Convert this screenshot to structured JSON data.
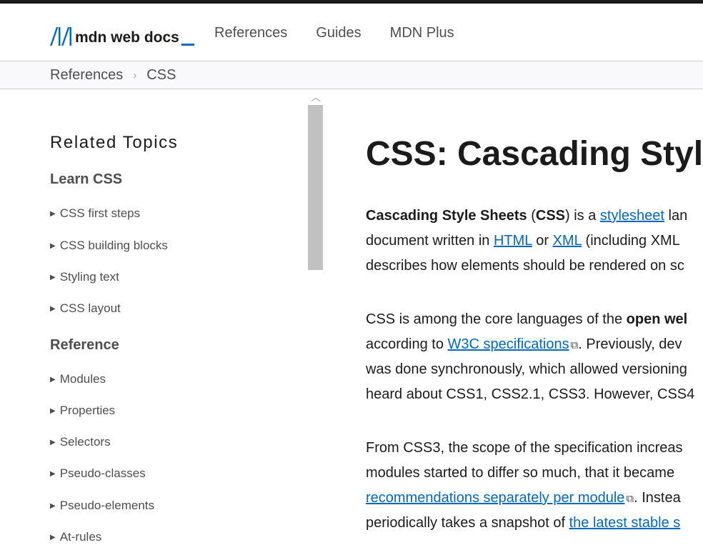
{
  "header": {
    "logo_text": "mdn web docs",
    "nav": [
      "References",
      "Guides",
      "MDN Plus"
    ]
  },
  "breadcrumb": [
    "References",
    "CSS"
  ],
  "sidebar": {
    "heading": "Related Topics",
    "learn": {
      "title": "Learn CSS",
      "items": [
        "CSS first steps",
        "CSS building blocks",
        "Styling text",
        "CSS layout"
      ]
    },
    "reference": {
      "title": "Reference",
      "items": [
        "Modules",
        "Properties",
        "Selectors",
        "Pseudo-classes",
        "Pseudo-elements",
        "At-rules"
      ]
    }
  },
  "article": {
    "title": "CSS: Cascading Styl",
    "p1": {
      "l1_bold1": "Cascading Style Sheets",
      "l1_t1": " (",
      "l1_bold2": "CSS",
      "l1_t2": ") is a ",
      "l1_link": "stylesheet",
      "l1_t3": " lan",
      "l2_t1": "document written in ",
      "l2_link1": "HTML",
      "l2_t2": " or ",
      "l2_link2": "XML",
      "l2_t3": " (including XML",
      "l3": "describes how elements should be rendered on sc"
    },
    "p2": {
      "l1_t1": "CSS is among the core languages of the ",
      "l1_bold": "open wel",
      "l2_t1": "according to ",
      "l2_link": "W3C specifications",
      "l2_t2": ". Previously, dev",
      "l3": "was done synchronously, which allowed versioning",
      "l4": "heard about CSS1, CSS2.1, CSS3. However, CSS4"
    },
    "p3": {
      "l1": "From CSS3, the scope of the specification increas",
      "l2": "modules started to differ so much, that it became",
      "l3_link": "recommendations separately per module",
      "l3_t1": ". Instea",
      "l4_t1": "periodically takes a snapshot of ",
      "l4_link": "the latest stable s"
    }
  },
  "colors": {
    "link": "#0069c2",
    "text": "#1b1b1b",
    "muted": "#4e4e4e",
    "accent": "#0069c2"
  }
}
